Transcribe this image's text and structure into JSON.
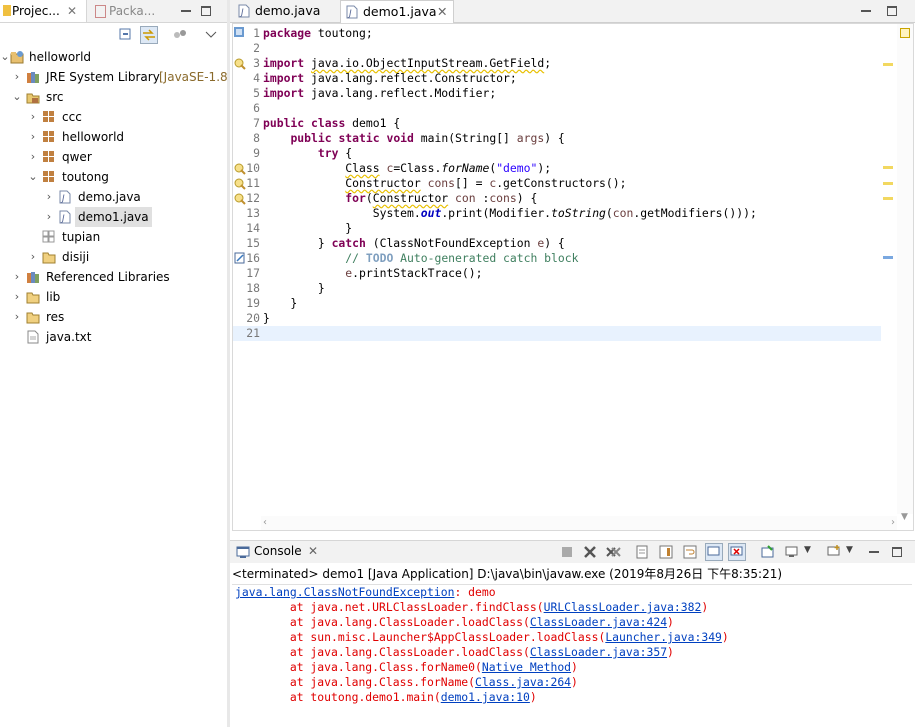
{
  "left": {
    "tabs": [
      {
        "label": "Projec..."
      },
      {
        "label": "Packa..."
      }
    ],
    "tree": [
      {
        "label": "helloworld"
      },
      {
        "label": "JRE System Library",
        "decoration": "[JavaSE-1.8"
      },
      {
        "label": "src"
      },
      {
        "label": "ccc"
      },
      {
        "label": "helloworld"
      },
      {
        "label": "qwer"
      },
      {
        "label": "toutong"
      },
      {
        "label": "demo.java"
      },
      {
        "label": "demo1.java"
      },
      {
        "label": "tupian"
      },
      {
        "label": "disiji"
      },
      {
        "label": "Referenced Libraries"
      },
      {
        "label": "lib"
      },
      {
        "label": "res"
      },
      {
        "label": "java.txt"
      }
    ]
  },
  "editor": {
    "tabs": [
      {
        "label": "demo.java"
      },
      {
        "label": "demo1.java"
      }
    ],
    "lines": [
      [
        {
          "t": "package",
          "c": "kw"
        },
        {
          "t": " toutong;"
        }
      ],
      [],
      [
        {
          "t": "import",
          "c": "kw"
        },
        {
          "t": " "
        },
        {
          "t": "java.io.ObjectInputStream.GetField",
          "c": "warn"
        },
        {
          "t": ";"
        }
      ],
      [
        {
          "t": "import",
          "c": "kw"
        },
        {
          "t": " java.lang.reflect.Constructor;"
        }
      ],
      [
        {
          "t": "import",
          "c": "kw"
        },
        {
          "t": " java.lang.reflect.Modifier;"
        }
      ],
      [],
      [
        {
          "t": "public",
          "c": "kw"
        },
        {
          "t": " "
        },
        {
          "t": "class",
          "c": "kw"
        },
        {
          "t": " demo1 {"
        }
      ],
      [
        {
          "t": "    "
        },
        {
          "t": "public",
          "c": "kw"
        },
        {
          "t": " "
        },
        {
          "t": "static",
          "c": "kw"
        },
        {
          "t": " "
        },
        {
          "t": "void",
          "c": "kw"
        },
        {
          "t": " main(String[] "
        },
        {
          "t": "args",
          "c": "var"
        },
        {
          "t": ") {"
        }
      ],
      [
        {
          "t": "        "
        },
        {
          "t": "try",
          "c": "kw"
        },
        {
          "t": " {"
        }
      ],
      [
        {
          "t": "            "
        },
        {
          "t": "Class",
          "c": "warn"
        },
        {
          "t": " "
        },
        {
          "t": "c",
          "c": "var"
        },
        {
          "t": "=Class."
        },
        {
          "t": "forName",
          "c": "it"
        },
        {
          "t": "("
        },
        {
          "t": "\"demo\"",
          "c": "str"
        },
        {
          "t": ");"
        }
      ],
      [
        {
          "t": "            "
        },
        {
          "t": "Constructor",
          "c": "warn"
        },
        {
          "t": " "
        },
        {
          "t": "cons",
          "c": "var"
        },
        {
          "t": "[] = "
        },
        {
          "t": "c",
          "c": "var"
        },
        {
          "t": ".getConstructors();"
        }
      ],
      [
        {
          "t": "            "
        },
        {
          "t": "for",
          "c": "kw"
        },
        {
          "t": "("
        },
        {
          "t": "Constructor",
          "c": "warn"
        },
        {
          "t": " "
        },
        {
          "t": "con",
          "c": "var"
        },
        {
          "t": " :"
        },
        {
          "t": "cons",
          "c": "var"
        },
        {
          "t": ") {"
        }
      ],
      [
        {
          "t": "                System."
        },
        {
          "t": "out",
          "c": "fld"
        },
        {
          "t": ".print(Modifier."
        },
        {
          "t": "toString",
          "c": "it"
        },
        {
          "t": "("
        },
        {
          "t": "con",
          "c": "var"
        },
        {
          "t": ".getModifiers()));"
        }
      ],
      [
        {
          "t": "            }"
        }
      ],
      [
        {
          "t": "        } "
        },
        {
          "t": "catch",
          "c": "kw"
        },
        {
          "t": " (ClassNotFoundException "
        },
        {
          "t": "e",
          "c": "var"
        },
        {
          "t": ") {"
        }
      ],
      [
        {
          "t": "            "
        },
        {
          "t": "// ",
          "c": "cm"
        },
        {
          "t": "TODO",
          "c": "todo"
        },
        {
          "t": " Auto-generated catch block",
          "c": "cm"
        }
      ],
      [
        {
          "t": "            "
        },
        {
          "t": "e",
          "c": "var"
        },
        {
          "t": ".printStackTrace();"
        }
      ],
      [
        {
          "t": "        }"
        }
      ],
      [
        {
          "t": "    }"
        }
      ],
      [
        {
          "t": "}"
        }
      ],
      []
    ],
    "warning_lines": [
      3,
      10,
      11,
      12
    ],
    "task_lines": [
      16
    ],
    "current_line": 21
  },
  "console": {
    "tab_label": "Console",
    "status": "<terminated> demo1 [Java Application] D:\\java\\bin\\javaw.exe (2019年8月26日 下午8:35:21)",
    "output": [
      [
        {
          "t": "java.lang.ClassNotFoundException",
          "c": "lnk"
        },
        {
          "t": ": demo"
        }
      ],
      [
        {
          "t": "\tat java.net.URLClassLoader.findClass("
        },
        {
          "t": "URLClassLoader.java:382",
          "c": "lnk"
        },
        {
          "t": ")"
        }
      ],
      [
        {
          "t": "\tat java.lang.ClassLoader.loadClass("
        },
        {
          "t": "ClassLoader.java:424",
          "c": "lnk"
        },
        {
          "t": ")"
        }
      ],
      [
        {
          "t": "\tat sun.misc.Launcher$AppClassLoader.loadClass("
        },
        {
          "t": "Launcher.java:349",
          "c": "lnk"
        },
        {
          "t": ")"
        }
      ],
      [
        {
          "t": "\tat java.lang.ClassLoader.loadClass("
        },
        {
          "t": "ClassLoader.java:357",
          "c": "lnk"
        },
        {
          "t": ")"
        }
      ],
      [
        {
          "t": "\tat java.lang.Class.forName0("
        },
        {
          "t": "Native Method",
          "c": "lnk"
        },
        {
          "t": ")"
        }
      ],
      [
        {
          "t": "\tat java.lang.Class.forName("
        },
        {
          "t": "Class.java:264",
          "c": "lnk"
        },
        {
          "t": ")"
        }
      ],
      [
        {
          "t": "\tat toutong.demo1.main("
        },
        {
          "t": "demo1.java:10",
          "c": "lnk"
        },
        {
          "t": ")"
        }
      ]
    ]
  },
  "colors": {
    "keyword": "#7f0055",
    "string": "#2a00ff",
    "comment": "#3f7f5f",
    "error": "#e00000",
    "link": "#0040c0"
  }
}
